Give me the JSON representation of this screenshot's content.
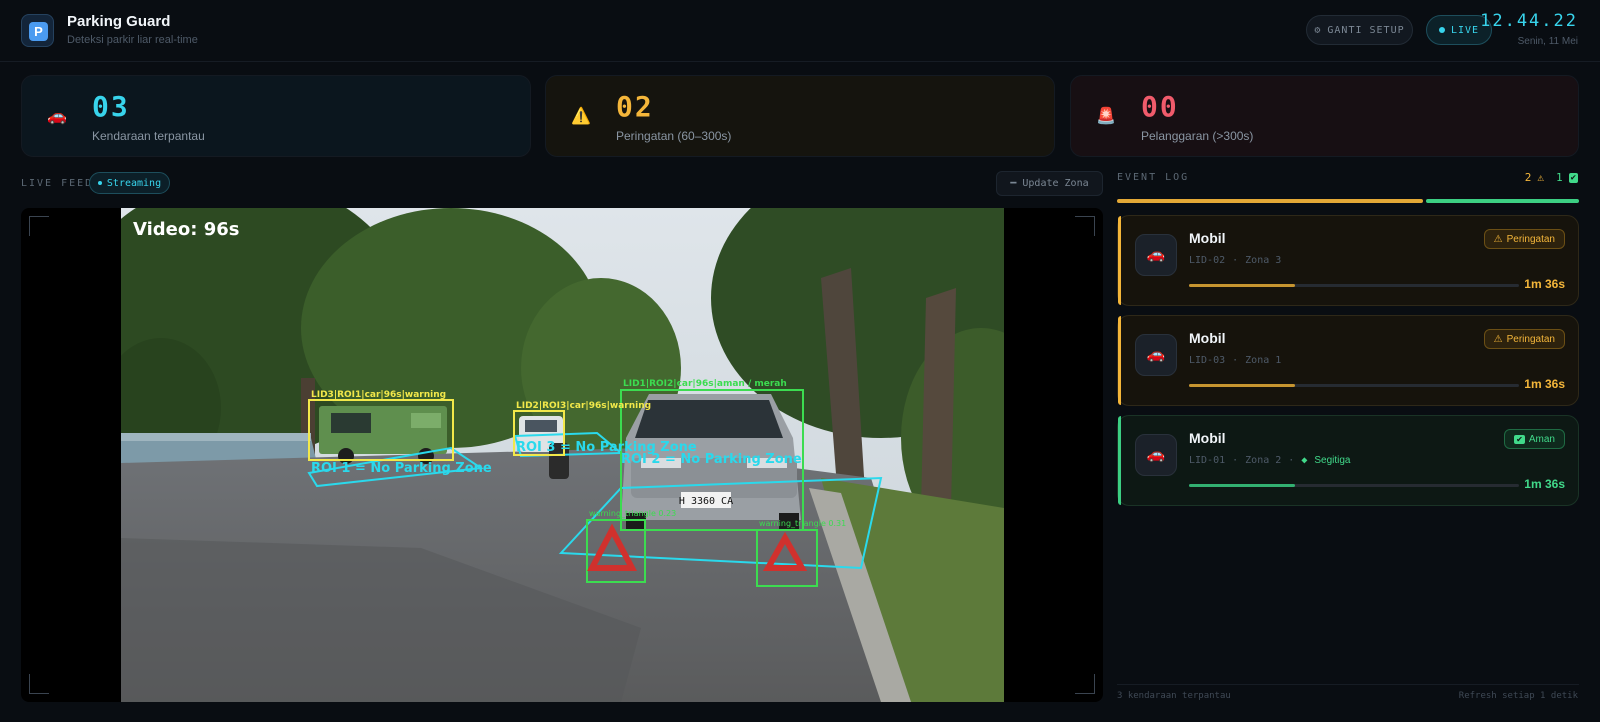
{
  "header": {
    "title": "Parking Guard",
    "subtitle": "Deteksi parkir liar real-time",
    "logo_letter": "P",
    "setup_button": "GANTI SETUP",
    "live_button": "LIVE",
    "clock": "12.44.22",
    "date": "Senin, 11 Mei"
  },
  "stats": [
    {
      "icon": "car-icon",
      "value": "03",
      "label": "Kendaraan terpantau",
      "color": "#38d4ec"
    },
    {
      "icon": "warning-icon",
      "value": "02",
      "label": "Peringatan (60–300s)",
      "color": "#f4b63a"
    },
    {
      "icon": "siren-icon",
      "value": "00",
      "label": "Pelanggaran (>300s)",
      "color": "#f05b6b"
    }
  ],
  "feed": {
    "label": "LIVE FEED",
    "status": "Streaming",
    "update_button": "Update Zona",
    "overlay": {
      "video_time": "Video: 96s",
      "box_lid3": "LID3|ROI1|car|96s|warning",
      "box_lid2": "LID2|ROI3|car|96s|warning",
      "box_lid1": "LID1|ROI2|car|96s|aman / merah",
      "zone1": "ROI 1 = No Parking Zone",
      "zone2": "ROI 2 = No Parking Zone",
      "zone3": "ROI 3 = No Parking Zone",
      "triangle1": "warning_triangle 0.23",
      "triangle2": "warning_triangle 0.31",
      "plate": "H 3360 CA"
    }
  },
  "event_log": {
    "label": "EVENT LOG",
    "warn_count": "2",
    "ok_count": "1",
    "events": [
      {
        "title": "Mobil",
        "id": "LID-02",
        "zone": "Zona 3",
        "extra": "",
        "badge": "Peringatan",
        "duration": "1m 36s",
        "status": "warning",
        "progress": 0.32
      },
      {
        "title": "Mobil",
        "id": "LID-03",
        "zone": "Zona 1",
        "extra": "",
        "badge": "Peringatan",
        "duration": "1m 36s",
        "status": "warning",
        "progress": 0.32
      },
      {
        "title": "Mobil",
        "id": "LID-01",
        "zone": "Zona 2",
        "extra": "Segitiga",
        "badge": "Aman",
        "duration": "1m 36s",
        "status": "ok",
        "progress": 0.32
      }
    ],
    "footer_left": "3 kendaraan terpantau",
    "footer_right": "Refresh setiap 1 detik"
  },
  "colors": {
    "accent": "#38d4ec",
    "warning": "#f4b63a",
    "danger": "#f05b6b",
    "ok": "#41d98a"
  }
}
